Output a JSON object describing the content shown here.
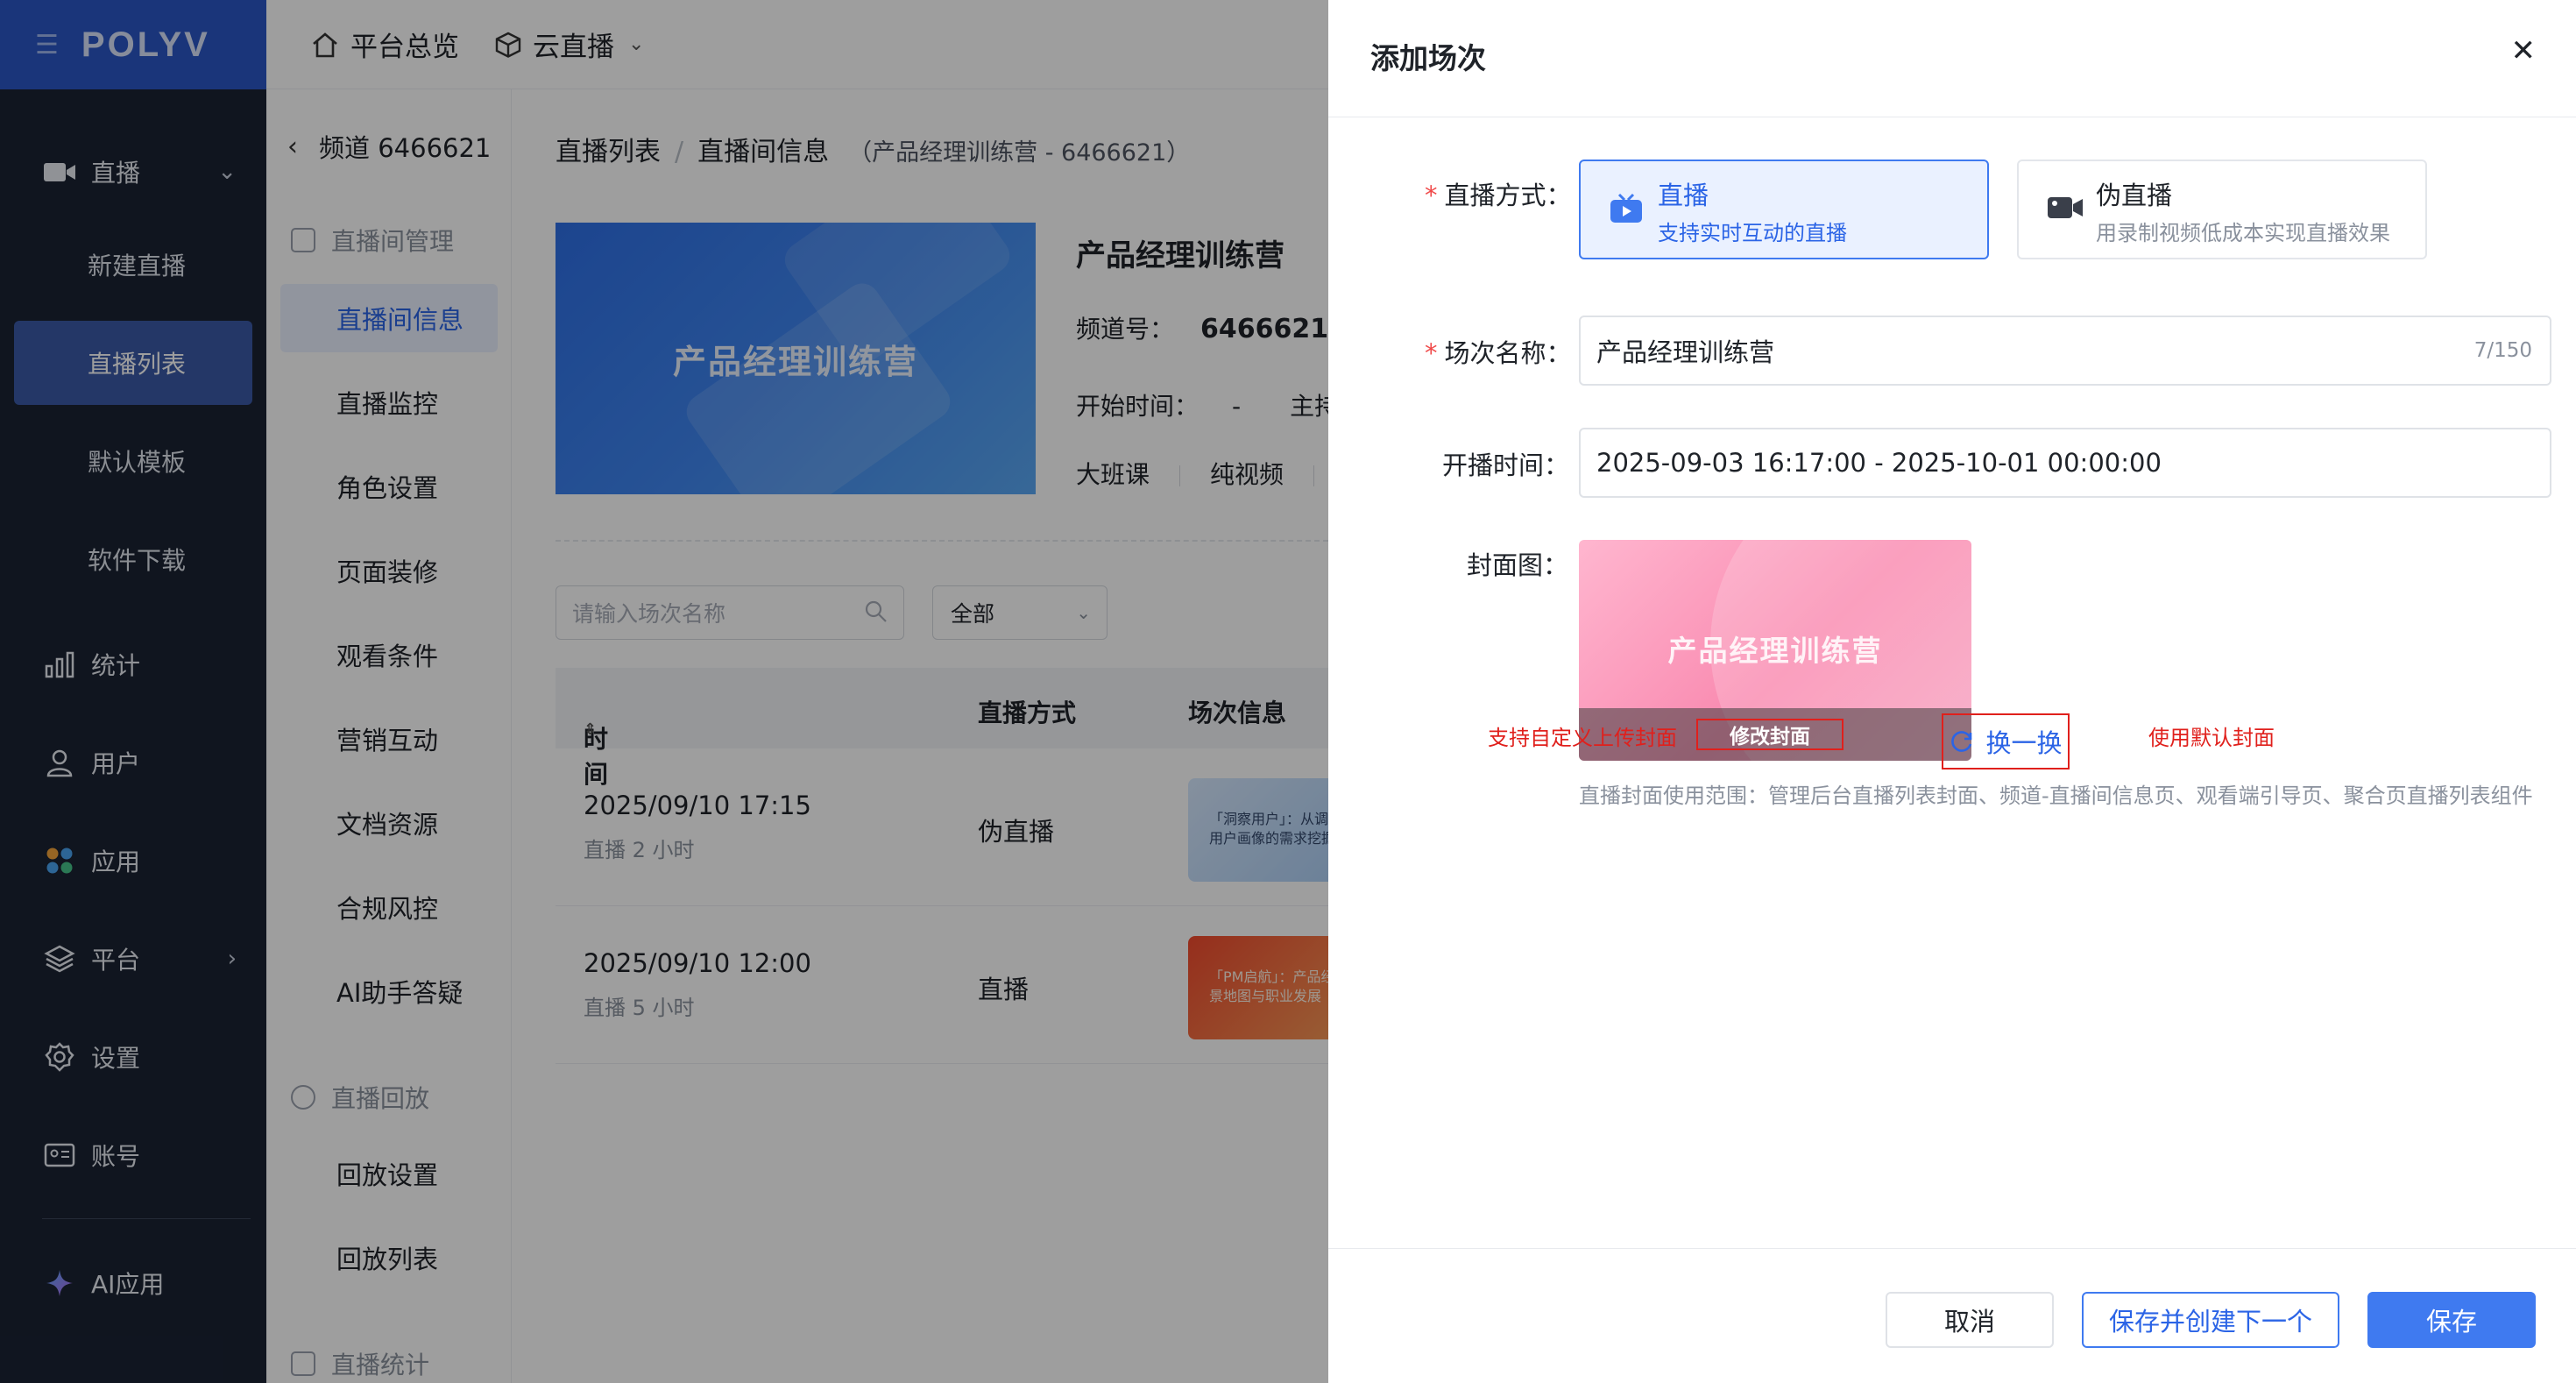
{
  "app": {
    "logo": "POLYV"
  },
  "sidebar": {
    "items": [
      {
        "label": "直播",
        "icon": "video-icon",
        "expanded": true
      },
      {
        "label": "统计",
        "icon": "bar-chart-icon"
      },
      {
        "label": "用户",
        "icon": "user-icon"
      },
      {
        "label": "应用",
        "icon": "apps-icon"
      },
      {
        "label": "平台",
        "icon": "layers-icon"
      },
      {
        "label": "设置",
        "icon": "gear-icon"
      },
      {
        "label": "账号",
        "icon": "id-card-icon"
      },
      {
        "label": "AI应用",
        "icon": "sparkle-icon"
      }
    ],
    "sub_items": [
      "新建直播",
      "直播列表",
      "默认模板",
      "软件下载"
    ],
    "active_sub": "直播列表"
  },
  "header": {
    "overview": "平台总览",
    "product": "云直播"
  },
  "subnav": {
    "back_label": "频道 6466621",
    "group1": "直播间管理",
    "items1": [
      "直播间信息",
      "直播监控",
      "角色设置",
      "页面装修",
      "观看条件",
      "营销互动",
      "文档资源",
      "合规风控",
      "AI助手答疑"
    ],
    "group2": "直播回放",
    "items2": [
      "回放设置",
      "回放列表"
    ],
    "group3": "直播统计"
  },
  "main": {
    "breadcrumb": [
      "直播列表",
      "直播间信息"
    ],
    "breadcrumb_note": "（产品经理训练营 - 6466621）",
    "banner_title": "产品经理训练营",
    "channel_title": "产品经理训练营",
    "channel_no_label": "频道号：",
    "channel_no": "6466621",
    "start_time_label": "开始时间：",
    "start_time_value": "-",
    "host_label": "主持人",
    "tags": [
      "大班课",
      "纯视频"
    ],
    "search_placeholder": "请输入场次名称",
    "filter_value": "全部",
    "table": {
      "headers": [
        "时间",
        "直播方式",
        "场次信息"
      ],
      "rows": [
        {
          "time": "2025/09/10 17:15",
          "duration": "直播 2 小时",
          "mode": "伪直播",
          "thumb": "「洞察用户」：从调研到用户画像的需求挖掘"
        },
        {
          "time": "2025/09/10 12:00",
          "duration": "直播 5 小时",
          "mode": "直播",
          "thumb": "「PM启航」：产品经理全景地图与职业发展"
        }
      ]
    }
  },
  "drawer": {
    "title": "添加场次",
    "mode_label": "直播方式：",
    "modes": [
      {
        "title": "直播",
        "desc": "支持实时互动的直播",
        "selected": true
      },
      {
        "title": "伪直播",
        "desc": "用录制视频低成本实现直播效果",
        "selected": false
      }
    ],
    "name_label": "场次名称：",
    "name_value": "产品经理训练营",
    "name_count": "7/150",
    "time_label": "开播时间：",
    "time_value": "2025-09-03 16:17:00 - 2025-10-01 00:00:00",
    "cover_label": "封面图：",
    "cover_title": "产品经理训练营",
    "cover_edit": "修改封面",
    "annotation_left": "支持自定义上传封面",
    "swap_label": "换一换",
    "annotation_right": "使用默认封面",
    "cover_hint": "直播封面使用范围：管理后台直播列表封面、频道-直播间信息页、观看端引导页、聚合页直播列表组件",
    "buttons": {
      "cancel": "取消",
      "save_next": "保存并创建下一个",
      "save": "保存"
    }
  },
  "colors": {
    "primary": "#3f7af0",
    "sidebar_bg": "#1a2233",
    "logo_bg": "#2a56c6",
    "annotation_red": "#e0201c"
  }
}
